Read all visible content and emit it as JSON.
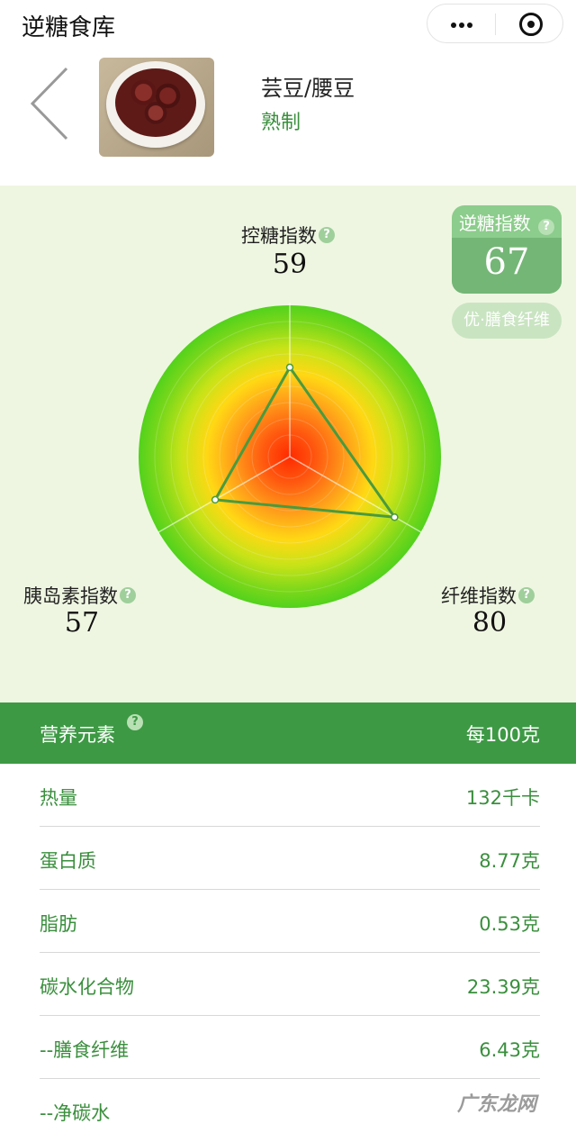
{
  "app": {
    "title": "逆糖食库"
  },
  "food": {
    "name": "芸豆/腰豆",
    "state": "熟制"
  },
  "radar": {
    "top_label": "控糖指数",
    "top_value": "59",
    "left_label": "胰岛素指数",
    "left_value": "57",
    "right_label": "纤维指数",
    "right_value": "80",
    "help_glyph": "?",
    "scores": {
      "control": 59,
      "insulin": 57,
      "fiber": 80
    }
  },
  "index_card": {
    "label": "逆糖指数",
    "value": "67",
    "tag": "优·膳食纤维"
  },
  "nutrition": {
    "title": "营养元素",
    "unit": "每100克",
    "rows": [
      {
        "name": "热量",
        "value": "132千卡"
      },
      {
        "name": "蛋白质",
        "value": "8.77克"
      },
      {
        "name": "脂肪",
        "value": "0.53克"
      },
      {
        "name": "碳水化合物",
        "value": "23.39克"
      },
      {
        "name": "--膳食纤维",
        "value": "6.43克"
      },
      {
        "name": "--净碳水",
        "value": ""
      }
    ]
  },
  "watermark": "广东龙网",
  "colors": {
    "primary_green": "#3d9944",
    "accent_green": "#3a8f3d",
    "panel_bg": "#eef6e1"
  }
}
